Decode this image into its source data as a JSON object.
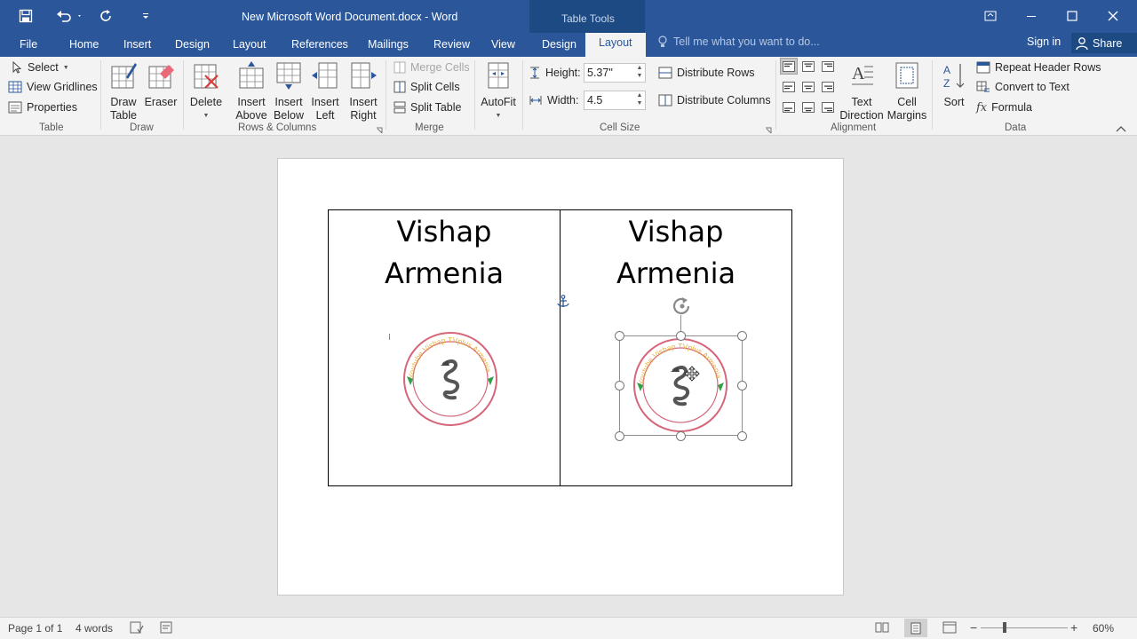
{
  "window": {
    "title": "New Microsoft Word Document.docx - Word",
    "context_tools_label": "Table Tools"
  },
  "tabs": {
    "file": "File",
    "home": "Home",
    "insert": "Insert",
    "design": "Design",
    "layout": "Layout",
    "references": "References",
    "mailings": "Mailings",
    "review": "Review",
    "view": "View",
    "table_design": "Design",
    "table_layout": "Layout"
  },
  "tell_me": "Tell me what you want to do...",
  "sign_in": "Sign in",
  "share": "Share",
  "ribbon": {
    "table": {
      "label": "Table",
      "select": "Select",
      "view_gridlines": "View Gridlines",
      "properties": "Properties"
    },
    "draw": {
      "label": "Draw",
      "draw_table_1": "Draw",
      "draw_table_2": "Table",
      "eraser": "Eraser"
    },
    "rows_columns": {
      "label": "Rows & Columns",
      "delete": "Delete",
      "insert_above_1": "Insert",
      "insert_above_2": "Above",
      "insert_below_1": "Insert",
      "insert_below_2": "Below",
      "insert_left_1": "Insert",
      "insert_left_2": "Left",
      "insert_right_1": "Insert",
      "insert_right_2": "Right"
    },
    "merge": {
      "label": "Merge",
      "merge_cells": "Merge Cells",
      "split_cells": "Split Cells",
      "split_table": "Split Table"
    },
    "autofit": "AutoFit",
    "cell_size": {
      "label": "Cell Size",
      "height_label": "Height:",
      "height_value": "5.37\"",
      "width_label": "Width:",
      "width_value": "4.5",
      "distribute_rows": "Distribute Rows",
      "distribute_columns": "Distribute Columns"
    },
    "alignment": {
      "label": "Alignment",
      "text_direction_1": "Text",
      "text_direction_2": "Direction",
      "cell_margins_1": "Cell",
      "cell_margins_2": "Margins"
    },
    "data": {
      "label": "Data",
      "sort": "Sort",
      "repeat_header_rows": "Repeat Header Rows",
      "convert_to_text": "Convert to Text",
      "formula": "Formula"
    }
  },
  "document": {
    "cell1_line1": "Vishap",
    "cell1_line2": "Armenia",
    "cell2_line1": "Vishap",
    "cell2_line2": "Armenia",
    "logo_ring_text": "Youtube Vishap TVplus Armenia"
  },
  "status": {
    "page": "Page 1 of 1",
    "words": "4 words",
    "zoom": "60%"
  },
  "colors": {
    "accent": "#2b579a",
    "context": "#1e4a84"
  }
}
